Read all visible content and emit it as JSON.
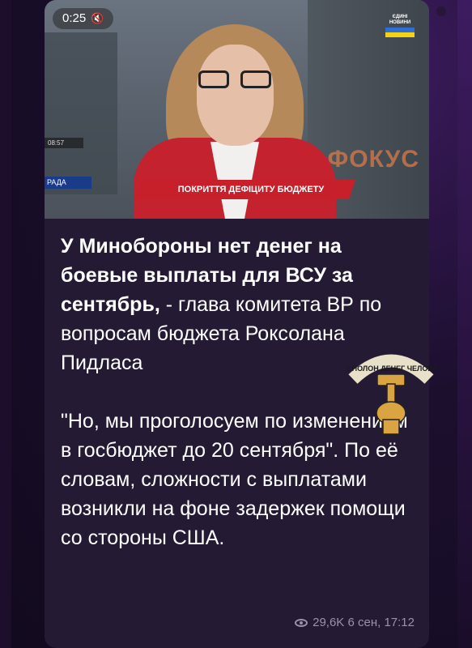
{
  "video": {
    "elapsed": "0:25",
    "mute_icon": "speaker-muted-icon",
    "channel_logo": "ЄДИНІ НОВИНИ",
    "lower_third": "ПОКРИТТЯ ДЕФІЦИТУ БЮДЖЕТУ",
    "focus_logo": "ФОКУС",
    "clock": "08:57",
    "rada": "РАДА"
  },
  "post": {
    "headline_bold": "У Минобороны нет денег на боевые выплаты для ВСУ за сентябрь,",
    "headline_rest": " - глава комитета ВР по вопросам бюджета Роксолана Пидласа",
    "quote": "\"Но, мы проголосуем по изменениям в госбюджет до 20 сентября\". По её словам, сложности с выплатами возникли на фоне задержек помощи со стороны США.",
    "views": "29,6K",
    "date": "6 сен, 17:12"
  },
  "badge": {
    "text": "НЕ ПОЛОН ДЕНЕГ ЧЕЛОВЕК"
  },
  "colors": {
    "card_bg": "#241a33",
    "text": "#ffffff",
    "meta": "#9d90ad",
    "lower_third": "#c7202b"
  }
}
